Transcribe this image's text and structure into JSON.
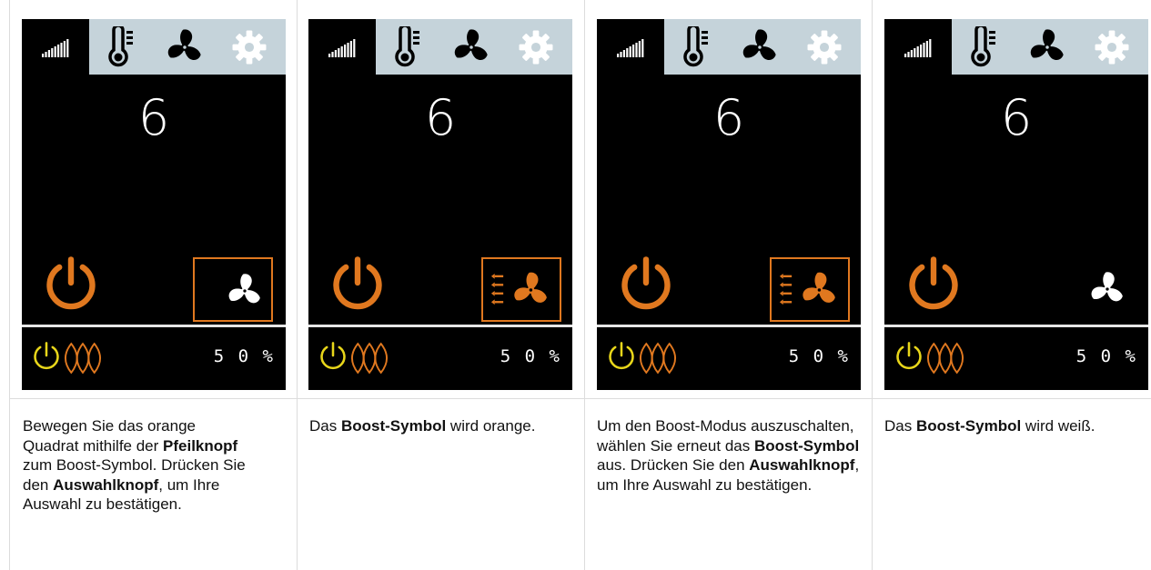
{
  "panels": [
    {
      "number": "6",
      "percent": "5 0  %",
      "boost_state": "selected-white",
      "caption": [
        {
          "text": "Bewegen Sie das orange Quadrat mithilfe der ",
          "bold": false
        },
        {
          "text": "Pfeilknopf",
          "bold": true
        },
        {
          "text": " zum Boost-Symbol. Drücken Sie den ",
          "bold": false
        },
        {
          "text": "Auswahlknopf",
          "bold": true
        },
        {
          "text": ", um Ihre Auswahl zu bestätigen.",
          "bold": false
        }
      ]
    },
    {
      "number": "6",
      "percent": "5 0  %",
      "boost_state": "selected-orange",
      "caption": [
        {
          "text": "Das ",
          "bold": false
        },
        {
          "text": "Boost-Symbol",
          "bold": true
        },
        {
          "text": " wird orange.",
          "bold": false
        }
      ]
    },
    {
      "number": "6",
      "percent": "5 0  %",
      "boost_state": "selected-orange",
      "caption": [
        {
          "text": "Um den Boost-Modus auszuschalten, wählen Sie erneut das ",
          "bold": false
        },
        {
          "text": "Boost-Symbol",
          "bold": true
        },
        {
          "text": " aus. Drücken Sie den ",
          "bold": false
        },
        {
          "text": "Auswahlknopf",
          "bold": true
        },
        {
          "text": ", um Ihre Auswahl zu bestätigen.",
          "bold": false
        }
      ]
    },
    {
      "number": "6",
      "percent": "5 0  %",
      "boost_state": "unselected-white",
      "caption": [
        {
          "text": "Das ",
          "bold": false
        },
        {
          "text": "Boost-Symbol",
          "bold": true
        },
        {
          "text": " wird weiß.",
          "bold": false
        }
      ]
    }
  ],
  "icons": {
    "tab1": "signal-level-icon",
    "tab2": "thermometer-icon",
    "tab3": "fan-icon",
    "tab4": "gear-icon",
    "power": "power-icon",
    "boost": "boost-fan-icon",
    "waves": "flame-waves-icon"
  },
  "colors": {
    "panel_bg": "#000000",
    "tabbar_bg": "#c5d3da",
    "orange": "#e0781f",
    "yellow": "#e8d61a",
    "white": "#ffffff"
  }
}
